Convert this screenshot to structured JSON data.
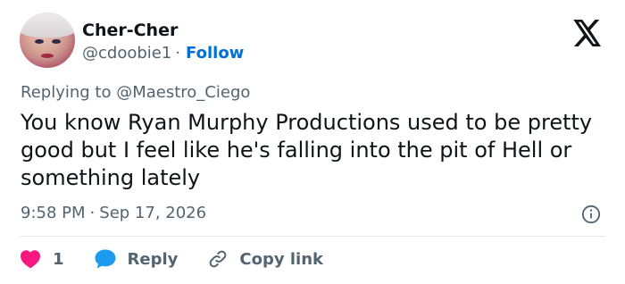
{
  "author": {
    "display_name": "Cher-Cher",
    "handle": "@cdoobie1",
    "separator": "·",
    "follow_label": "Follow"
  },
  "reply_context": {
    "prefix": "Replying to",
    "mention": "@Maestro_Ciego"
  },
  "tweet": {
    "text": "You know Ryan Murphy Productions used to be pretty good but I feel like he's falling into the pit of Hell or something lately",
    "time": "9:58 PM",
    "separator": "·",
    "date": "Sep 17, 2026"
  },
  "actions": {
    "like_count": "1",
    "reply_label": "Reply",
    "copy_label": "Copy link"
  },
  "icons": {
    "brand": "x-logo-icon",
    "info": "info-icon",
    "like": "heart-icon",
    "reply": "speech-bubble-icon",
    "copy": "link-icon"
  },
  "colors": {
    "text": "#0f1419",
    "secondary": "#536471",
    "follow": "#006fd6",
    "like": "#f91880",
    "reply": "#1d9bf0",
    "divider": "#e1e8ed"
  }
}
